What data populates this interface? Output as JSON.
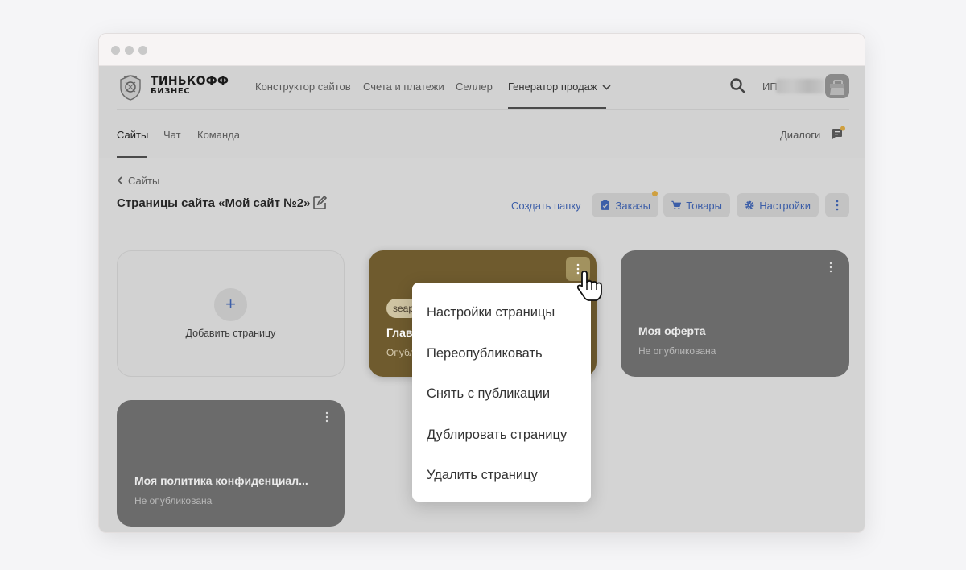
{
  "brand": {
    "line1": "ТИНЬКОФФ",
    "line2": "БИЗНЕС"
  },
  "topnav": {
    "items": [
      "Конструктор сайтов",
      "Счета и платежи",
      "Селлер",
      "Генератор продаж"
    ],
    "account_prefix": "ИП"
  },
  "subnav": {
    "tabs": [
      "Сайты",
      "Чат",
      "Команда"
    ],
    "dialogs": "Диалоги"
  },
  "page": {
    "back": "Сайты",
    "title": "Страницы сайта «Мой сайт №2»"
  },
  "toolbar": {
    "create_folder": "Создать папку",
    "orders": "Заказы",
    "products": "Товары",
    "settings": "Настройки"
  },
  "cards": {
    "add": "Добавить страницу",
    "main": {
      "tag": "seap",
      "title": "Глав",
      "status": "Опубл"
    },
    "oferta": {
      "title": "Моя оферта",
      "status": "Не опубликована"
    },
    "policy": {
      "title": "Моя политика конфиденциал...",
      "status": "Не опубликована"
    }
  },
  "menu": {
    "items": [
      "Настройки страницы",
      "Переопубликовать",
      "Снять с публикации",
      "Дублировать страницу",
      "Удалить страницу"
    ]
  },
  "colors": {
    "accent": "#3c5ea8",
    "main_card": "#6f5b2e",
    "overlay_gray": "#d2d2d2",
    "badge": "#cfa040"
  }
}
